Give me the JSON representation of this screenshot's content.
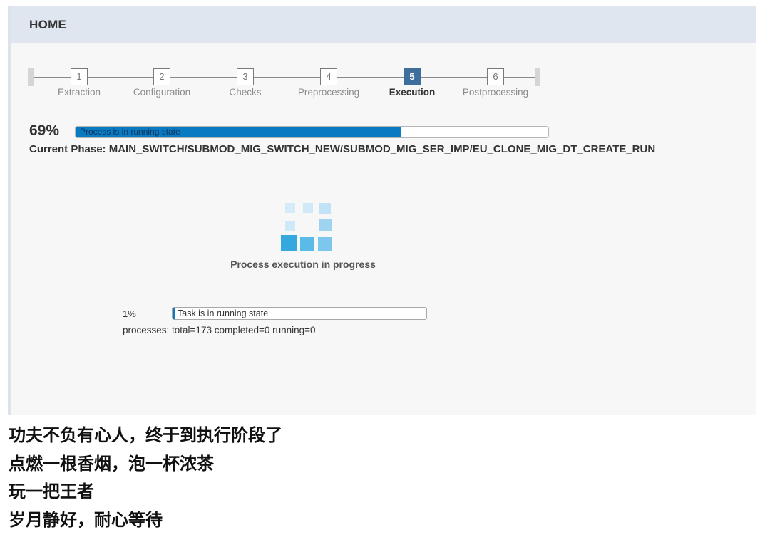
{
  "header": {
    "title": "HOME"
  },
  "stepper": {
    "active_index": 4,
    "steps": [
      {
        "number": "1",
        "label": "Extraction"
      },
      {
        "number": "2",
        "label": "Configuration"
      },
      {
        "number": "3",
        "label": "Checks"
      },
      {
        "number": "4",
        "label": "Preprocessing"
      },
      {
        "number": "5",
        "label": "Execution"
      },
      {
        "number": "6",
        "label": "Postprocessing"
      }
    ]
  },
  "main_progress": {
    "percent_label": "69%",
    "value": 0.69,
    "status_text": "Process is in running state",
    "phase": "Current Phase: MAIN_SWITCH/SUBMOD_MIG_SWITCH_NEW/SUBMOD_MIG_SER_IMP/EU_CLONE_MIG_DT_CREATE_RUN"
  },
  "loader": {
    "text": "Process execution in progress"
  },
  "task_progress": {
    "percent_label": "1%",
    "value": 0.01,
    "status_text": "Task is in running state",
    "processes": "processes: total=173 completed=0 running=0"
  },
  "caption": {
    "lines": [
      "功夫不负有心人，终于到执行阶段了",
      "点燃一根香烟，泡一杯浓茶",
      "玩一把王者",
      "岁月静好，耐心等待"
    ]
  },
  "colors": {
    "header_bg": "#dfe6ef",
    "accent": "#0a7ac2",
    "active_step": "#3d6e9c",
    "loader_dark": "#35a8df",
    "loader_light": "#c9e6f7"
  }
}
